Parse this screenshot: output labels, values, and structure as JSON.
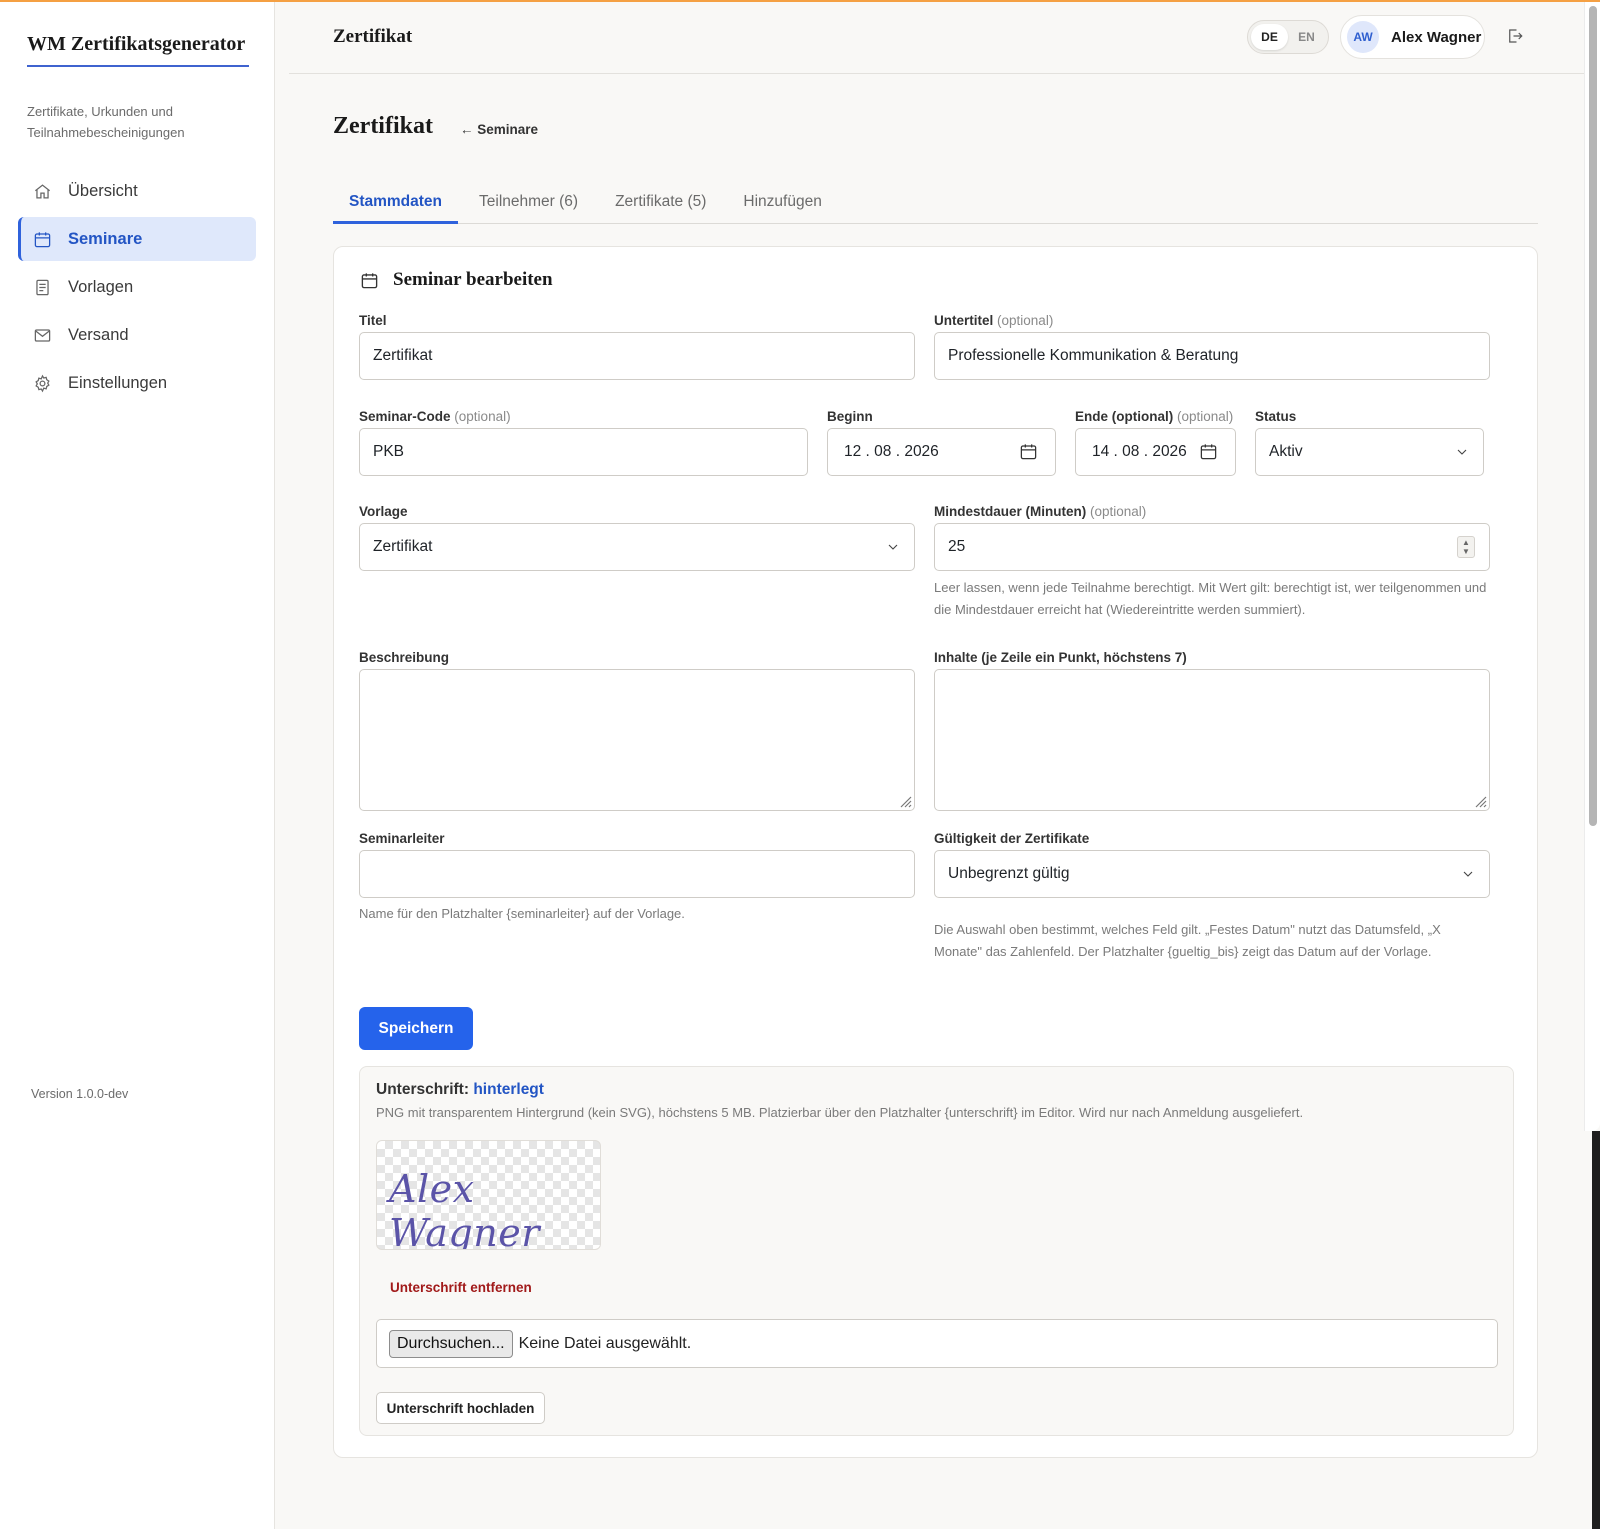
{
  "app": {
    "brand_title": "WM Zertifikatsgenerator",
    "brand_subtitle": "Zertifikate, Urkunden und Teilnahmebescheinigungen",
    "version": "Version 1.0.0-dev",
    "accent_color": "#2563eb"
  },
  "sidebar": {
    "items": [
      {
        "label": "Übersicht",
        "icon": "home-icon",
        "active": false
      },
      {
        "label": "Seminare",
        "icon": "calendar-icon",
        "active": true
      },
      {
        "label": "Vorlagen",
        "icon": "document-icon",
        "active": false
      },
      {
        "label": "Versand",
        "icon": "mail-icon",
        "active": false
      },
      {
        "label": "Einstellungen",
        "icon": "gear-icon",
        "active": false
      }
    ]
  },
  "header": {
    "title": "Zertifikat",
    "lang_de": "DE",
    "lang_en": "EN",
    "active_lang": "DE",
    "user_initials": "AW",
    "user_name": "Alex Wagner",
    "logout_icon": "logout-icon"
  },
  "page": {
    "title": "Zertifikat",
    "back_link": "← Seminare"
  },
  "tabs": [
    {
      "label": "Stammdaten",
      "active": true
    },
    {
      "label": "Teilnehmer (6)",
      "active": false
    },
    {
      "label": "Zertifikate (5)",
      "active": false
    },
    {
      "label": "Hinzufügen",
      "active": false
    }
  ],
  "form": {
    "card_title": "Seminar bearbeiten",
    "optional_suffix": "(optional)",
    "titel": {
      "label": "Titel",
      "value": "Zertifikat"
    },
    "untertitel": {
      "label": "Untertitel",
      "value": "Professionelle Kommunikation & Beratung"
    },
    "seminar_code": {
      "label": "Seminar-Code",
      "value": "PKB"
    },
    "beginn": {
      "label": "Beginn",
      "value": "12 . 08 . 2026"
    },
    "ende": {
      "label": "Ende (optional)",
      "value": "14 . 08 . 2026"
    },
    "status": {
      "label": "Status",
      "value": "Aktiv"
    },
    "vorlage": {
      "label": "Vorlage",
      "value": "Zertifikat"
    },
    "mindestdauer": {
      "label": "Mindestdauer (Minuten)",
      "value": "25",
      "help": "Leer lassen, wenn jede Teilnahme berechtigt. Mit Wert gilt: berechtigt ist, wer teilgenommen und die Mindestdauer erreicht hat (Wiedereintritte werden summiert)."
    },
    "beschreibung": {
      "label": "Beschreibung",
      "value": ""
    },
    "inhalte": {
      "label": "Inhalte (je Zeile ein Punkt, höchstens 7)",
      "value": ""
    },
    "seminarleiter": {
      "label": "Seminarleiter",
      "value": "",
      "help": "Name für den Platzhalter {seminarleiter} auf der Vorlage."
    },
    "gueltigkeit": {
      "label": "Gültigkeit der Zertifikate",
      "value": "Unbegrenzt gültig",
      "help": "Die Auswahl oben bestimmt, welches Feld gilt. „Festes Datum\" nutzt das Datumsfeld, „X Monate\" das Zahlenfeld. Der Platzhalter {gueltig_bis} zeigt das Datum auf der Vorlage."
    },
    "save_label": "Speichern"
  },
  "signature": {
    "title_prefix": "Unterschrift:",
    "state": "hinterlegt",
    "help": "PNG mit transparentem Hintergrund (kein SVG), höchstens 5 MB. Platzierbar über den Platzhalter {unterschrift} im Editor. Wird nur nach Anmeldung ausgeliefert.",
    "preview_text": "Alex Wagner",
    "remove_label": "Unterschrift entfernen",
    "file_button": "Durchsuchen...",
    "file_status": "Keine Datei ausgewählt.",
    "upload_label": "Unterschrift hochladen"
  }
}
